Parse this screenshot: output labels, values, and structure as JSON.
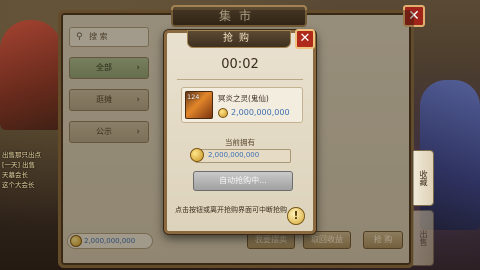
{
  "market": {
    "title": "集市",
    "close_icon": "✕",
    "search_placeholder": "搜 索",
    "tabs": [
      {
        "label": "全部"
      },
      {
        "label": "逛摊"
      },
      {
        "label": "公示"
      }
    ],
    "currency_value": "2,000,000,000",
    "bottom_buttons": {
      "sell": "我要摆卖",
      "collect": "取回收益",
      "buy": "抢 购"
    },
    "right_tabs": [
      "收藏",
      "出售"
    ]
  },
  "chat_log": [
    "出售那只出点",
    "[一天] 出售",
    "天墓会长",
    "这个大会长"
  ],
  "dialog": {
    "title": "抢购",
    "timer": "00:02",
    "item": {
      "level": "124",
      "name": "冥炎之灵(鬼仙)",
      "price": "2,000,000,000"
    },
    "owned_label": "当前拥有",
    "owned_value": "2,000,000,000",
    "auto_button": "自动抢购中...",
    "hint": "点击按钮或离开抢购界面可中断抢购",
    "warn_icon": "!"
  },
  "colors": {
    "frame": "#8a6a3e",
    "price_blue": "#3d6fb0",
    "close_red": "#b02a1c"
  }
}
